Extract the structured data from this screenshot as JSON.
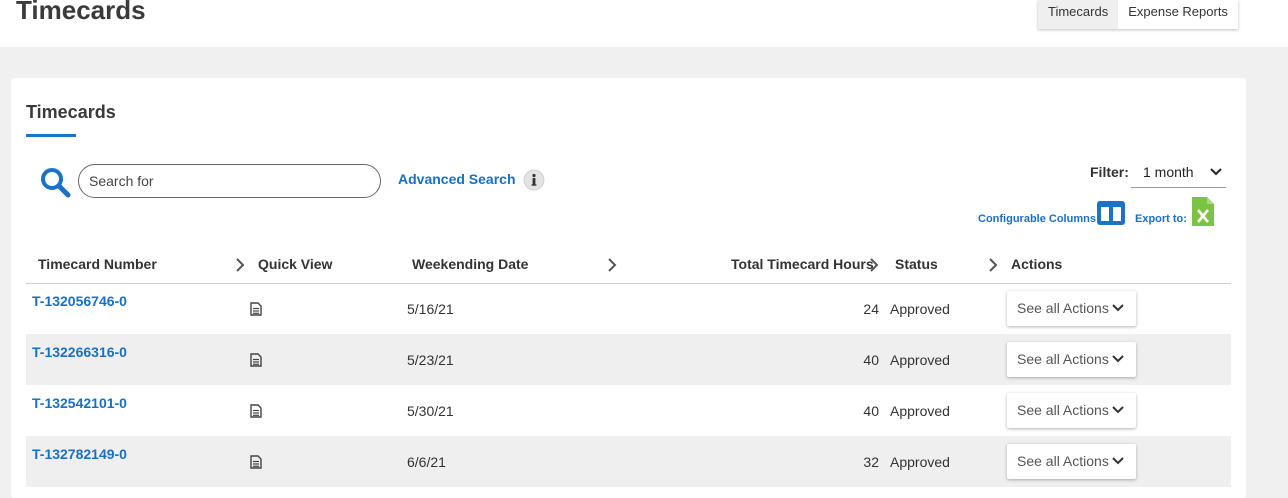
{
  "page": {
    "title": "Timecards"
  },
  "top_tabs": [
    {
      "label": "Timecards",
      "active": true
    },
    {
      "label": "Expense Reports",
      "active": false
    }
  ],
  "card": {
    "title": "Timecards"
  },
  "search": {
    "placeholder": "Search for",
    "value": "",
    "advanced_label": "Advanced Search"
  },
  "filter": {
    "label": "Filter:",
    "selected": "1 month"
  },
  "configurable_columns_label": "Configurable Columns:",
  "export_label": "Export to:",
  "columns": {
    "timecard_number": "Timecard Number",
    "quick_view": "Quick View",
    "weekending_date": "Weekending Date",
    "total_hours": "Total Timecard Hours",
    "status": "Status",
    "actions": "Actions"
  },
  "rows": [
    {
      "number": "T-132056746-0",
      "date": "5/16/21",
      "hours": "24",
      "status": "Approved",
      "action": "See all Actions"
    },
    {
      "number": "T-132266316-0",
      "date": "5/23/21",
      "hours": "40",
      "status": "Approved",
      "action": "See all Actions"
    },
    {
      "number": "T-132542101-0",
      "date": "5/30/21",
      "hours": "40",
      "status": "Approved",
      "action": "See all Actions"
    },
    {
      "number": "T-132782149-0",
      "date": "6/6/21",
      "hours": "32",
      "status": "Approved",
      "action": "See all Actions"
    }
  ],
  "colors": {
    "link": "#1a6fc2",
    "accent": "#1a73c8",
    "excel": "#7cc243"
  }
}
